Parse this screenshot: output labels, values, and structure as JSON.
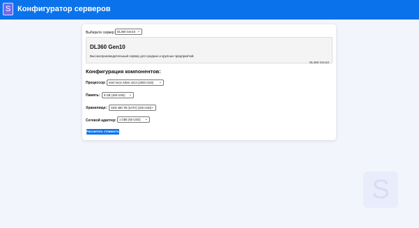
{
  "header": {
    "logo_letter": "S",
    "title": "Конфигуратор серверов"
  },
  "server_select": {
    "label": "Выберите сервер:",
    "value": "DL360 Gen10"
  },
  "server_info": {
    "name": "DL360 Gen10",
    "description": "Высокопроизводительный сервер для средних и крупных предприятий.",
    "image_alt": "DL360 Gen10"
  },
  "config": {
    "heading": "Конфигурация компонентов:",
    "processor": {
      "label": "Процессор:",
      "value": "Intel Xeon Silver 4214 (2000 USD)"
    },
    "memory": {
      "label": "Память:",
      "value": "8 GB (150 USD)"
    },
    "storage": {
      "label": "Хранилище:",
      "value": "SSD 480 TB (SATA) (100 USD)"
    },
    "network": {
      "label": "Сетевой адаптер:",
      "value": "1 GbE (50 USD)"
    },
    "calculate_label": "Рассчитать стоимость"
  },
  "watermark_letter": "S",
  "colors": {
    "header_bg": "#0a73ec",
    "button_bg": "#0a73ec",
    "page_bg": "#f2f5fb"
  }
}
